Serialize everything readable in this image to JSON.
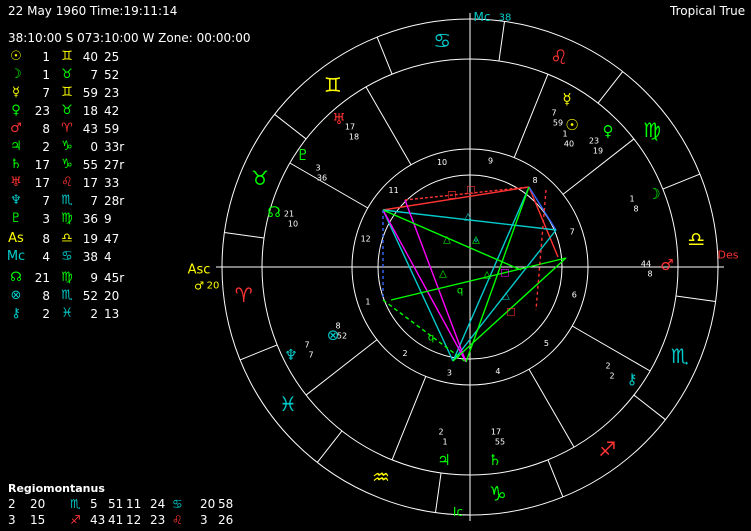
{
  "header": {
    "datetime": "22 May 1960 Time:19:11:14",
    "location": "38:10:00 S 073:10:00 W Zone: 00:00:00",
    "zodiac": "Tropical True"
  },
  "colors": {
    "background": "#000000",
    "yellow": "#ffff00",
    "green": "#00ff00",
    "cyan": "#00cccc",
    "red": "#ff3333",
    "magenta": "#ff00ff",
    "blue": "#3366ff",
    "white": "#ffffff"
  },
  "planets": [
    {
      "name": "Sun",
      "glyph": "☉",
      "deg": "1",
      "sign": "♊",
      "min": "40",
      "sec": "25",
      "color": "#ffff00",
      "signColor": "#ffff00"
    },
    {
      "name": "Moon",
      "glyph": "☽",
      "deg": "1",
      "sign": "♉",
      "min": "7",
      "sec": "52",
      "color": "#00ff00",
      "signColor": "#00ff00"
    },
    {
      "name": "Mercury",
      "glyph": "☿",
      "deg": "7",
      "sign": "♊",
      "min": "59",
      "sec": "23",
      "color": "#ffff00",
      "signColor": "#ffff00"
    },
    {
      "name": "Venus",
      "glyph": "♀",
      "deg": "23",
      "sign": "♉",
      "min": "18",
      "sec": "42",
      "color": "#00ff00",
      "signColor": "#00ff00"
    },
    {
      "name": "Mars",
      "glyph": "♂",
      "deg": "8",
      "sign": "♈",
      "min": "43",
      "sec": "59",
      "color": "#ff3333",
      "signColor": "#ff3333"
    },
    {
      "name": "Jupiter",
      "glyph": "♃",
      "deg": "2",
      "sign": "♑",
      "min": "0",
      "sec": "33r",
      "color": "#00ff00",
      "signColor": "#00ff00"
    },
    {
      "name": "Saturn",
      "glyph": "♄",
      "deg": "17",
      "sign": "♑",
      "min": "55",
      "sec": "27r",
      "color": "#00ff00",
      "signColor": "#00ff00"
    },
    {
      "name": "Uranus",
      "glyph": "♅",
      "deg": "17",
      "sign": "♌",
      "min": "17",
      "sec": "33",
      "color": "#ff3333",
      "signColor": "#ff3333"
    },
    {
      "name": "Neptune",
      "glyph": "♆",
      "deg": "7",
      "sign": "♏",
      "min": "7",
      "sec": "28r",
      "color": "#00cccc",
      "signColor": "#00cccc"
    },
    {
      "name": "Pluto",
      "glyph": "♇",
      "deg": "3",
      "sign": "♍",
      "min": "36",
      "sec": "9",
      "color": "#00ff00",
      "signColor": "#00ff00"
    },
    {
      "name": "Ascendant",
      "glyph": "As",
      "deg": "8",
      "sign": "♎",
      "min": "19",
      "sec": "47",
      "color": "#ffff00",
      "signColor": "#ffff00"
    },
    {
      "name": "Midheaven",
      "glyph": "Mc",
      "deg": "4",
      "sign": "♋",
      "min": "38",
      "sec": "4",
      "color": "#00cccc",
      "signColor": "#00cccc"
    },
    {
      "name": "Node",
      "glyph": "☊",
      "deg": "21",
      "sign": "♍",
      "min": "9",
      "sec": "45r",
      "color": "#00ff00",
      "signColor": "#00ff00"
    },
    {
      "name": "Part of Fortune",
      "glyph": "⊗",
      "deg": "8",
      "sign": "♏",
      "min": "52",
      "sec": "20",
      "color": "#00cccc",
      "signColor": "#00cccc"
    },
    {
      "name": "Chiron",
      "glyph": "⚷",
      "deg": "2",
      "sign": "♓",
      "min": "2",
      "sec": "13",
      "color": "#00cccc",
      "signColor": "#00cccc"
    }
  ],
  "houses_system": "Regiomontanus",
  "house_rows": [
    [
      {
        "t": "2",
        "c": "#ffffff"
      },
      {
        "t": "20",
        "c": "#ffffff"
      },
      {
        "t": "♏",
        "c": "#00cccc"
      },
      {
        "t": "5",
        "c": "#ffffff"
      },
      {
        "t": "51",
        "c": "#ffffff"
      },
      {
        "t": "11",
        "c": "#ffffff"
      },
      {
        "t": "24",
        "c": "#ffffff"
      },
      {
        "t": "♋",
        "c": "#00cccc"
      },
      {
        "t": "20",
        "c": "#ffffff"
      },
      {
        "t": "58",
        "c": "#ffffff"
      }
    ],
    [
      {
        "t": "3",
        "c": "#ffffff"
      },
      {
        "t": "15",
        "c": "#ffffff"
      },
      {
        "t": "♐",
        "c": "#ff3333"
      },
      {
        "t": "43",
        "c": "#ffffff"
      },
      {
        "t": "41",
        "c": "#ffffff"
      },
      {
        "t": "12",
        "c": "#ffffff"
      },
      {
        "t": "23",
        "c": "#ffffff"
      },
      {
        "t": "♌",
        "c": "#ff3333"
      },
      {
        "t": "3",
        "c": "#ffffff"
      },
      {
        "t": "26",
        "c": "#ffffff"
      }
    ]
  ],
  "wheel": {
    "angle_labels": {
      "asc": "Asc",
      "des": "Des",
      "mc": "Mc",
      "ic": "Ic",
      "mc_value": "38",
      "asc_value": "20"
    },
    "zodiac_glyphs": [
      {
        "glyph": "♋",
        "color": "#00cccc"
      },
      {
        "glyph": "♊",
        "color": "#ffff00"
      },
      {
        "glyph": "♉",
        "color": "#00ff00"
      },
      {
        "glyph": "♈",
        "color": "#ff3333"
      },
      {
        "glyph": "♓",
        "color": "#00cccc"
      },
      {
        "glyph": "♒",
        "color": "#ffff00"
      },
      {
        "glyph": "♑",
        "color": "#00ff00"
      },
      {
        "glyph": "♐",
        "color": "#ff3333"
      },
      {
        "glyph": "♏",
        "color": "#00cccc"
      },
      {
        "glyph": "♎",
        "color": "#ffff00"
      },
      {
        "glyph": "♍",
        "color": "#00ff00"
      },
      {
        "glyph": "♌",
        "color": "#ff3333"
      }
    ],
    "house_numbers": [
      "1",
      "2",
      "3",
      "4",
      "5",
      "6",
      "7",
      "8",
      "9",
      "10",
      "11",
      "12"
    ],
    "planet_marks": [
      {
        "name": "uranus",
        "glyph": "♅",
        "color": "#ff3333",
        "deg": "17",
        "min": "18"
      },
      {
        "name": "pluto",
        "glyph": "♇",
        "color": "#00ff00",
        "deg": "3",
        "min": "36"
      },
      {
        "name": "node",
        "glyph": "☊",
        "color": "#00ff00",
        "deg": "21",
        "min": "10"
      },
      {
        "name": "fortune",
        "glyph": "⊗",
        "color": "#00cccc",
        "deg": "8",
        "min": "52"
      },
      {
        "name": "neptune",
        "glyph": "♆",
        "color": "#00cccc",
        "deg": "7",
        "min": "7"
      },
      {
        "name": "mercury",
        "glyph": "☿",
        "color": "#ffff00",
        "deg": "7",
        "min": "59"
      },
      {
        "name": "sun",
        "glyph": "☉",
        "color": "#ffff00",
        "deg": "1",
        "min": "40"
      },
      {
        "name": "venus",
        "glyph": "♀",
        "color": "#00ff00",
        "deg": "23",
        "min": "19"
      },
      {
        "name": "moon",
        "glyph": "☽",
        "color": "#00ff00",
        "deg": "1",
        "min": "8"
      },
      {
        "name": "mars",
        "glyph": "♂",
        "color": "#ff3333",
        "deg": "44",
        "min": "8"
      },
      {
        "name": "chiron",
        "glyph": "⚷",
        "color": "#00cccc",
        "deg": "2",
        "min": "2"
      },
      {
        "name": "jupiter",
        "glyph": "♃",
        "color": "#00ff00",
        "deg": "2",
        "min": "1"
      },
      {
        "name": "saturn",
        "glyph": "♄",
        "color": "#00ff00",
        "deg": "17",
        "min": "55"
      }
    ],
    "aspect_glyphs": [
      "□",
      "□",
      "□",
      "△",
      "△",
      "△",
      "△",
      "△",
      "△",
      "□",
      "q",
      "q",
      "ᵩ"
    ]
  }
}
